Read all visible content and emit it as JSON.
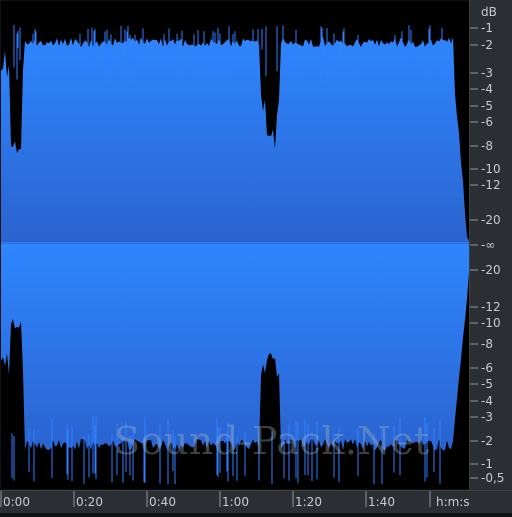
{
  "app": {
    "title": "Waveform Overview",
    "colors": {
      "background": "#0f1316",
      "wave_fill": "#2f7fff",
      "wave_fill_bottom": "#2a67d6",
      "panel": "#2b2f33",
      "text": "#c6cbd0"
    }
  },
  "scale": {
    "unit_label": "dB",
    "labels": [
      "-1",
      "-2",
      "-3",
      "-4",
      "-5",
      "-6",
      "-8",
      "-10",
      "-12",
      "-20",
      "-∞",
      "-20",
      "-12",
      "-10",
      "-8",
      "-6",
      "-5",
      "-4",
      "-3",
      "-2",
      "-1",
      "-0,5"
    ]
  },
  "time_axis": {
    "labels": [
      "0:00",
      "0:20",
      "0:40",
      "1:00",
      "1:20",
      "1:40",
      "h:m:s"
    ]
  },
  "watermark": {
    "text": "Sound-Pack.Net"
  }
}
